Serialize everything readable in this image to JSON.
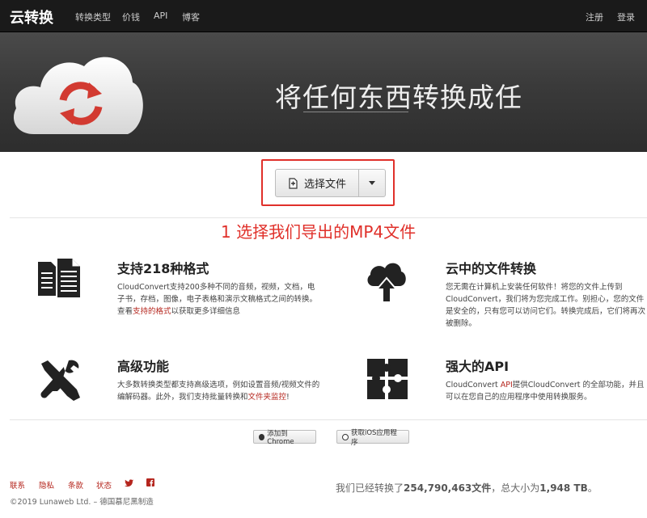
{
  "navbar": {
    "brand": "云转换",
    "links": [
      "转换类型",
      "价钱",
      "API",
      "博客"
    ],
    "right_links": [
      "注册",
      "登录"
    ]
  },
  "hero": {
    "title": "将任何东西转换成任"
  },
  "upload": {
    "select_label": "选择文件",
    "annotation": "1 选择我们导出的MP4文件",
    "highlight_color": "#e0302a"
  },
  "features": [
    {
      "icon": "documents-icon",
      "title": "支持218种格式",
      "text_before": "CloudConvert支持200多种不同的音频，视频，文档，电子书，存档，图像，电子表格和演示文稿格式之间的转换。查看",
      "link": "支持的格式",
      "text_after": "以获取更多详细信息"
    },
    {
      "icon": "cloud-upload-icon",
      "title": "云中的文件转换",
      "text_before": "您无需在计算机上安装任何软件！将您的文件上传到CloudConvert，我们将为您完成工作。别担心，您的文件是安全的，只有您可以访问它们。转换完成后，它们将再次被删除。",
      "link": "",
      "text_after": ""
    },
    {
      "icon": "tools-icon",
      "title": "高级功能",
      "text_before": "大多数转换类型都支持高级选项，例如设置音频/视频文件的编解码器。此外，我们支持批量转换和",
      "link": "文件夹监控",
      "text_after": "!"
    },
    {
      "icon": "puzzle-icon",
      "title": "强大的API",
      "text_before": "CloudConvert ",
      "link": "API",
      "text_after": "提供CloudConvert 的全部功能，并且可以在您自己的应用程序中使用转换服务。"
    }
  ],
  "extensions": {
    "chrome": "添加到Chrome",
    "ios": "获取iOS应用程序"
  },
  "footer": {
    "links": [
      "联系",
      "隐私",
      "条款",
      "状态"
    ],
    "copyright": "©2019 Lunaweb Ltd. – 德国慕尼黑制造",
    "stats_prefix": "我们已经转换了",
    "files_count": "254,790,463文件",
    "stats_mid": "，总大小为",
    "total_size": "1,948 TB",
    "stats_suffix": "。"
  },
  "colors": {
    "accent": "#e0302a",
    "link": "#b5261e",
    "navbar": "#1a1a1a"
  }
}
